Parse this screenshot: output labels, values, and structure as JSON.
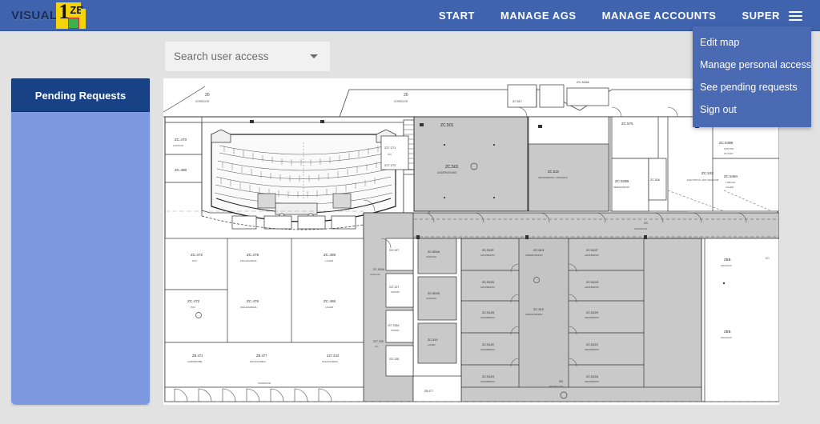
{
  "header": {
    "brand": {
      "text_left": "VISUAL",
      "digit": "1",
      "text_right": "ZE",
      "logo_icon": "visualize-logo"
    },
    "nav": [
      {
        "label": "START",
        "name": "nav-start"
      },
      {
        "label": "MANAGE AGS",
        "name": "nav-manage-ags"
      },
      {
        "label": "MANAGE ACCOUNTS",
        "name": "nav-manage-accounts"
      },
      {
        "label": "SUPER",
        "name": "nav-super"
      }
    ],
    "menu_icon": "hamburger-icon",
    "colors": {
      "navbar": "#3f63ad",
      "dropdown": "#4a6ab4"
    }
  },
  "dropdown": {
    "open": true,
    "items": [
      {
        "label": "Edit map",
        "name": "menu-edit-map"
      },
      {
        "label": "Manage personal access",
        "name": "menu-manage-personal-access"
      },
      {
        "label": "See pending requests",
        "name": "menu-see-pending-requests"
      },
      {
        "label": "Sign out",
        "name": "menu-sign-out"
      }
    ]
  },
  "search": {
    "placeholder": "Search user access",
    "value": "",
    "caret_icon": "chevron-down-icon"
  },
  "sidebar": {
    "panel_title": "Pending Requests",
    "body_empty": true,
    "colors": {
      "header": "#174286",
      "body": "#7d9ae0"
    }
  },
  "map": {
    "type": "floor-plan",
    "alt": "Architectural floor plan drawing with auditorium, corridors and offices",
    "rooms": [
      {
        "label": "227.270",
        "sub": "TRAPPE"
      },
      {
        "label": "227.280",
        "sub": "TRAPPE"
      },
      {
        "label": "227.271",
        "sub": ""
      },
      {
        "label": "ZC.472",
        "sub": "PAUSEROM"
      },
      {
        "label": "ZC.476",
        "sub": "FELLESAREAL"
      },
      {
        "label": "ZC.486",
        "sub": "LAGER"
      },
      {
        "label": "ZC.488",
        "sub": "LAGER"
      },
      {
        "label": "ZB.477",
        "sub": "GARDEROBE"
      },
      {
        "label": "ZB.471",
        "sub": "GARDEROBE"
      },
      {
        "label": "227.234",
        "sub": "TRAPPEROM"
      },
      {
        "label": "227.235",
        "sub": "WC"
      },
      {
        "label": "227.233A",
        "sub": "TRAPPE"
      },
      {
        "label": "227.227",
        "sub": "TEKNISK"
      },
      {
        "label": "ZC.501",
        "sub": "UNDERVISNING"
      },
      {
        "label": "ZC.516A",
        "sub": ""
      },
      {
        "label": "ZC.517",
        "sub": "WC"
      },
      {
        "label": "ZC.516",
        "sub": "VF / BOD"
      },
      {
        "label": "ZC.525A",
        "sub": ""
      },
      {
        "label": "ZC.525B",
        "sub": "SEMINARROM"
      },
      {
        "label": "ZC.526",
        "sub": "KORRIDOR"
      },
      {
        "label": "ZC.575",
        "sub": ""
      },
      {
        "label": "ZC.532",
        "sub": "ELECTRICAL AND TELECOM"
      },
      {
        "label": "ZC.549B",
        "sub": "KONTOR"
      },
      {
        "label": "ZC.549A",
        "sub": ""
      },
      {
        "label": "ZC.512F",
        "sub": "GRUPPEROM"
      },
      {
        "label": "ZC.512D",
        "sub": "GRUPPEROM"
      },
      {
        "label": "ZC.512B",
        "sub": "GRUPPEROM"
      },
      {
        "label": "ZC.512H",
        "sub": "GRUPPEROM"
      },
      {
        "label": "ZC.512E",
        "sub": "GRUPPEROM"
      },
      {
        "label": "ZC.512G",
        "sub": "GRUPPEROM"
      },
      {
        "label": "ZC.512C",
        "sub": "GRUPPEROM"
      },
      {
        "label": "ZC.512A",
        "sub": "GRUPPEROM"
      },
      {
        "label": "ZC.513",
        "sub": "UNDERVISNING"
      },
      {
        "label": "ZC.512",
        "sub": "UNDERVISNING"
      },
      {
        "label": "ZC.500A",
        "sub": "GANGVEI"
      },
      {
        "label": "ZC.500D",
        "sub": "GANGVEI"
      },
      {
        "label": "ZC.519",
        "sub": "LAGER"
      },
      {
        "label": "ZB",
        "sub": "RESEPSJON"
      },
      {
        "label": "ZC",
        "sub": "KORRIDOR"
      },
      {
        "label": "ZBB",
        "sub": "SELSKAP"
      }
    ],
    "shaded_fill": "#c9c9c9",
    "line_color": "#2c2c2c"
  }
}
